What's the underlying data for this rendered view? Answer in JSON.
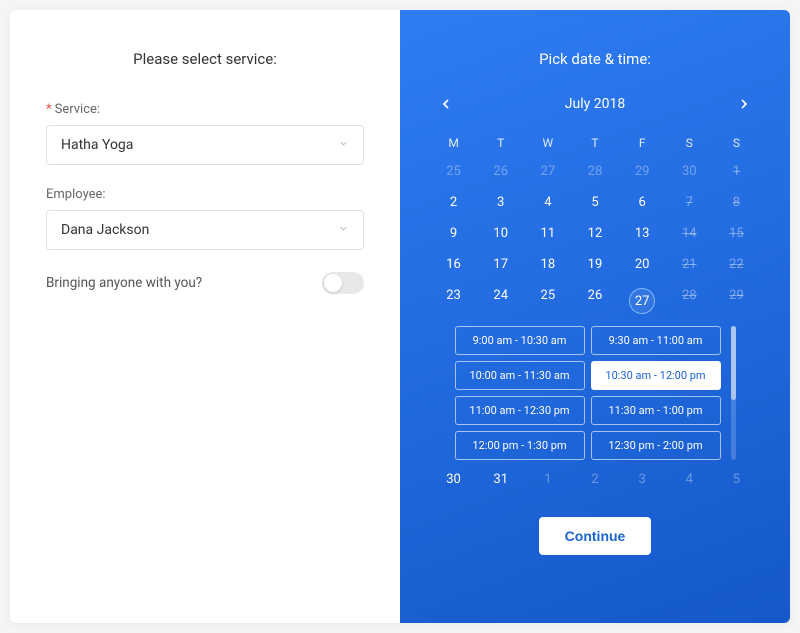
{
  "left": {
    "title": "Please select service:",
    "service_label": "Service:",
    "service_value": "Hatha Yoga",
    "employee_label": "Employee:",
    "employee_value": "Dana Jackson",
    "bringing_label": "Bringing anyone with you?",
    "bringing_on": false
  },
  "right": {
    "title": "Pick date & time:",
    "month_label": "July 2018",
    "dow": [
      "M",
      "T",
      "W",
      "T",
      "F",
      "S",
      "S"
    ],
    "weeks": [
      [
        {
          "n": 25,
          "state": "faded"
        },
        {
          "n": 26,
          "state": "faded"
        },
        {
          "n": 27,
          "state": "faded"
        },
        {
          "n": 28,
          "state": "faded"
        },
        {
          "n": 29,
          "state": "faded"
        },
        {
          "n": 30,
          "state": "faded"
        },
        {
          "n": 1,
          "state": "struck"
        }
      ],
      [
        {
          "n": 2,
          "state": "normal"
        },
        {
          "n": 3,
          "state": "normal"
        },
        {
          "n": 4,
          "state": "normal"
        },
        {
          "n": 5,
          "state": "normal"
        },
        {
          "n": 6,
          "state": "normal"
        },
        {
          "n": 7,
          "state": "struck"
        },
        {
          "n": 8,
          "state": "struck"
        }
      ],
      [
        {
          "n": 9,
          "state": "normal"
        },
        {
          "n": 10,
          "state": "normal"
        },
        {
          "n": 11,
          "state": "normal"
        },
        {
          "n": 12,
          "state": "normal"
        },
        {
          "n": 13,
          "state": "normal"
        },
        {
          "n": 14,
          "state": "struck"
        },
        {
          "n": 15,
          "state": "struck"
        }
      ],
      [
        {
          "n": 16,
          "state": "normal"
        },
        {
          "n": 17,
          "state": "normal"
        },
        {
          "n": 18,
          "state": "normal"
        },
        {
          "n": 19,
          "state": "normal"
        },
        {
          "n": 20,
          "state": "normal"
        },
        {
          "n": 21,
          "state": "struck"
        },
        {
          "n": 22,
          "state": "struck"
        }
      ],
      [
        {
          "n": 23,
          "state": "normal"
        },
        {
          "n": 24,
          "state": "normal"
        },
        {
          "n": 25,
          "state": "normal"
        },
        {
          "n": 26,
          "state": "normal"
        },
        {
          "n": 27,
          "state": "selected"
        },
        {
          "n": 28,
          "state": "struck"
        },
        {
          "n": 29,
          "state": "struck"
        }
      ],
      [
        {
          "n": 30,
          "state": "normal"
        },
        {
          "n": 31,
          "state": "normal"
        },
        {
          "n": 1,
          "state": "faded"
        },
        {
          "n": 2,
          "state": "faded"
        },
        {
          "n": 3,
          "state": "faded"
        },
        {
          "n": 4,
          "state": "faded"
        },
        {
          "n": 5,
          "state": "faded"
        }
      ]
    ],
    "timeslots": [
      {
        "label": "9:00 am - 10:30 am",
        "selected": false
      },
      {
        "label": "9:30 am - 11:00 am",
        "selected": false
      },
      {
        "label": "10:00 am - 11:30 am",
        "selected": false
      },
      {
        "label": "10:30 am - 12:00 pm",
        "selected": true
      },
      {
        "label": "11:00 am - 12:30 pm",
        "selected": false
      },
      {
        "label": "11:30 am - 1:00 pm",
        "selected": false
      },
      {
        "label": "12:00 pm - 1:30 pm",
        "selected": false
      },
      {
        "label": "12:30 pm - 2:00 pm",
        "selected": false
      }
    ],
    "continue_label": "Continue"
  }
}
